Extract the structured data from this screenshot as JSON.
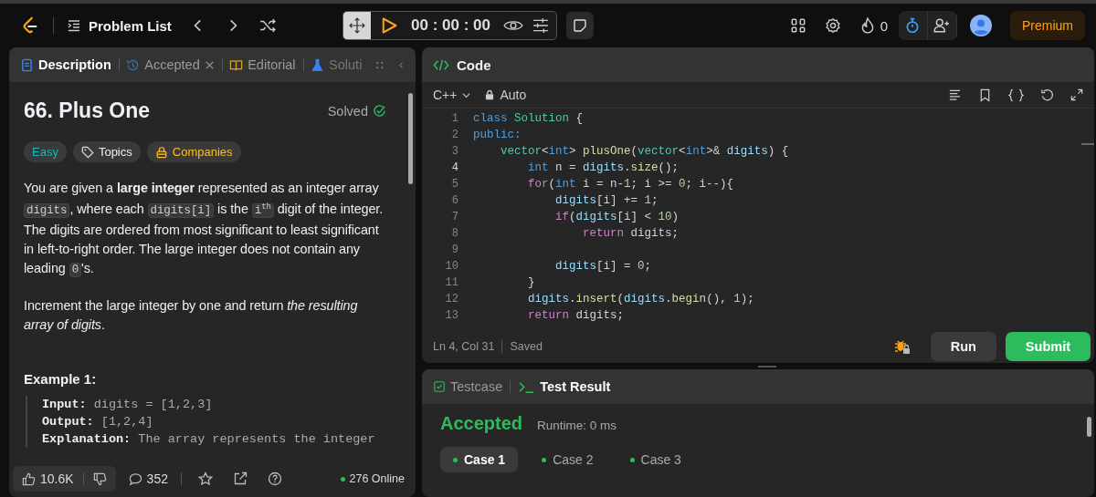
{
  "top_bar": {
    "nav_title": "Problem List",
    "timer": "00 : 00 : 00",
    "streak": "0",
    "premium": "Premium"
  },
  "left_panel": {
    "tabs": [
      {
        "kind": "description",
        "label": "Description",
        "selected": true,
        "closable": false
      },
      {
        "kind": "accepted",
        "label": "Accepted",
        "selected": false,
        "closable": true
      },
      {
        "kind": "editorial",
        "label": "Editorial",
        "selected": false,
        "closable": false
      },
      {
        "kind": "solutions",
        "label": "Soluti",
        "selected": false,
        "closable": false
      }
    ]
  },
  "problem": {
    "title": "66. Plus One",
    "status": "Solved",
    "difficulty": "Easy",
    "tags": [
      {
        "kind": "topics",
        "label": "Topics"
      },
      {
        "kind": "companies",
        "label": "Companies"
      }
    ],
    "paragraphs": [
      [
        {
          "kind": "text",
          "text": "You are given a **large integer** represented as an integer array "
        },
        {
          "kind": "code",
          "text": "digits"
        },
        {
          "kind": "text",
          "text": ", where each "
        },
        {
          "kind": "code",
          "text": "digits[i]"
        },
        {
          "kind": "text",
          "text": " is the "
        },
        {
          "kind": "code",
          "text": "i$^{th}$"
        },
        {
          "kind": "text",
          "text": " digit of the integer. The digits are ordered from most significant to least significant in left-to-right order. The large integer does not contain any leading "
        },
        {
          "kind": "code",
          "text": "0"
        },
        {
          "kind": "text",
          "text": "'s."
        }
      ],
      [
        {
          "kind": "text",
          "text": "Increment the large integer by one and return *the resulting array of digits*."
        }
      ]
    ],
    "example": {
      "heading": "Example 1:",
      "lines": [
        {
          "label": "Input:",
          "value": "digits = [1,2,3]"
        },
        {
          "label": "Output:",
          "value": "[1,2,4]"
        },
        {
          "label": "Explanation:",
          "value": "The array represents the integer"
        }
      ]
    }
  },
  "footer": {
    "likes": "10.6K",
    "comments": "352",
    "online": "276 Online"
  },
  "editor": {
    "title": "Code",
    "language": "C++",
    "mode": "Auto",
    "lines": [
      {
        "number": "1",
        "current": false,
        "tokens": [
          {
            "kind": "kw",
            "text": "class"
          },
          {
            "kind": "type",
            "text": " Solution"
          },
          {
            "kind": "p",
            "text": " {"
          }
        ]
      },
      {
        "number": "2",
        "current": false,
        "tokens": [
          {
            "kind": "kw",
            "text": "public:"
          }
        ]
      },
      {
        "number": "3",
        "current": false,
        "tokens": [
          {
            "kind": "type",
            "text": "    vector"
          },
          {
            "kind": "p",
            "text": "<"
          },
          {
            "kind": "kw",
            "text": "int"
          },
          {
            "kind": "p",
            "text": "> "
          },
          {
            "kind": "fn",
            "text": "plusOne"
          },
          {
            "kind": "p",
            "text": "("
          },
          {
            "kind": "type",
            "text": "vector"
          },
          {
            "kind": "p",
            "text": "<"
          },
          {
            "kind": "kw",
            "text": "int"
          },
          {
            "kind": "p",
            "text": ">& "
          },
          {
            "kind": "var",
            "text": "digits"
          },
          {
            "kind": "p",
            "text": ") {"
          }
        ]
      },
      {
        "number": "4",
        "current": true,
        "tokens": [
          {
            "kind": "kw",
            "text": "        int"
          },
          {
            "kind": "p",
            "text": " n = "
          },
          {
            "kind": "var",
            "text": "digits"
          },
          {
            "kind": "p",
            "text": "."
          },
          {
            "kind": "fn",
            "text": "size"
          },
          {
            "kind": "p",
            "text": "();"
          }
        ]
      },
      {
        "number": "5",
        "current": false,
        "tokens": [
          {
            "kind": "ctrl",
            "text": "        for"
          },
          {
            "kind": "p",
            "text": "("
          },
          {
            "kind": "kw",
            "text": "int"
          },
          {
            "kind": "p",
            "text": " i = n-"
          },
          {
            "kind": "num",
            "text": "1"
          },
          {
            "kind": "p",
            "text": "; i >= "
          },
          {
            "kind": "num",
            "text": "0"
          },
          {
            "kind": "p",
            "text": "; i--){"
          }
        ]
      },
      {
        "number": "6",
        "current": false,
        "tokens": [
          {
            "kind": "var",
            "text": "            digits"
          },
          {
            "kind": "p",
            "text": "[i] += "
          },
          {
            "kind": "num",
            "text": "1"
          },
          {
            "kind": "p",
            "text": ";"
          }
        ]
      },
      {
        "number": "7",
        "current": false,
        "tokens": [
          {
            "kind": "ctrl",
            "text": "            if"
          },
          {
            "kind": "p",
            "text": "("
          },
          {
            "kind": "var",
            "text": "digits"
          },
          {
            "kind": "p",
            "text": "[i] < "
          },
          {
            "kind": "num",
            "text": "10"
          },
          {
            "kind": "p",
            "text": ")"
          }
        ]
      },
      {
        "number": "8",
        "current": false,
        "tokens": [
          {
            "kind": "ctrl",
            "text": "                return"
          },
          {
            "kind": "p",
            "text": " digits;"
          }
        ]
      },
      {
        "number": "9",
        "current": false
      },
      {
        "number": "10",
        "current": false,
        "tokens": [
          {
            "kind": "var",
            "text": "            digits"
          },
          {
            "kind": "p",
            "text": "[i] = "
          },
          {
            "kind": "num",
            "text": "0"
          },
          {
            "kind": "p",
            "text": ";"
          }
        ]
      },
      {
        "number": "11",
        "current": false,
        "tokens": [
          {
            "kind": "p",
            "text": "        }"
          }
        ]
      },
      {
        "number": "12",
        "current": false,
        "tokens": [
          {
            "kind": "var",
            "text": "        digits"
          },
          {
            "kind": "p",
            "text": "."
          },
          {
            "kind": "fn",
            "text": "insert"
          },
          {
            "kind": "p",
            "text": "("
          },
          {
            "kind": "var",
            "text": "digits"
          },
          {
            "kind": "p",
            "text": "."
          },
          {
            "kind": "fn",
            "text": "begin"
          },
          {
            "kind": "p",
            "text": "(), "
          },
          {
            "kind": "num",
            "text": "1"
          },
          {
            "kind": "p",
            "text": ");"
          }
        ]
      },
      {
        "number": "13",
        "current": false,
        "tokens": [
          {
            "kind": "ctrl",
            "text": "        return"
          },
          {
            "kind": "p",
            "text": " digits;"
          }
        ]
      }
    ],
    "position": "Ln 4, Col 31",
    "save_state": "Saved",
    "buttons": [
      {
        "kind": "run",
        "label": "Run"
      },
      {
        "kind": "submit",
        "label": "Submit"
      }
    ]
  },
  "results": {
    "tabs": [
      {
        "kind": "testcase",
        "label": "Testcase",
        "selected": false
      },
      {
        "kind": "result",
        "label": "Test Result",
        "selected": true
      }
    ],
    "verdict": "Accepted",
    "runtime": "Runtime: 0 ms",
    "cases": [
      {
        "label": "Case 1",
        "selected": true
      },
      {
        "label": "Case 2",
        "selected": false
      },
      {
        "label": "Case 3",
        "selected": false
      }
    ]
  }
}
